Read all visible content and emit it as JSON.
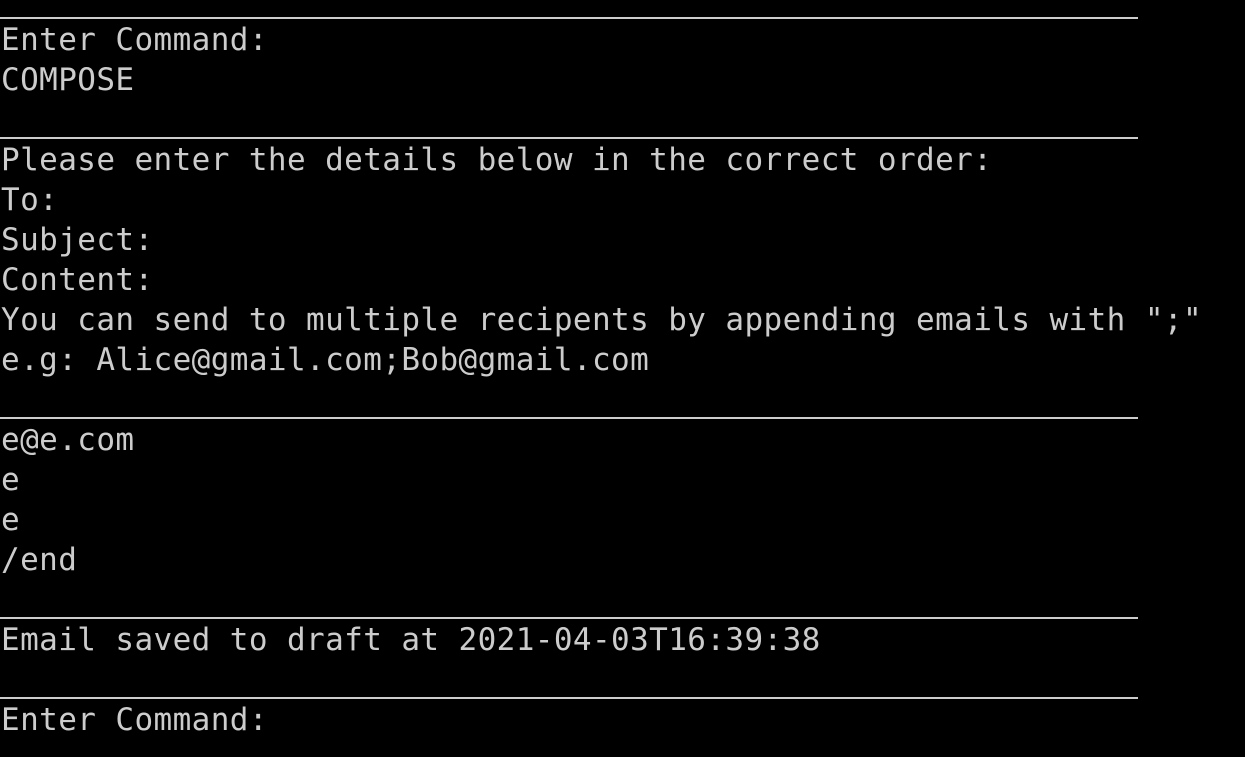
{
  "terminal": {
    "colors": {
      "background": "#000000",
      "foreground": "#cccccc"
    },
    "lines": {
      "prompt1": "Enter Command:",
      "input_command": "COMPOSE",
      "instructions": "Please enter the details below in the correct order:",
      "to_label": "To:",
      "subject_label": "Subject:",
      "content_label": "Content:",
      "hint_multiple": "You can send to multiple recipents by appending emails with \";\"",
      "hint_example": "e.g: Alice@gmail.com;Bob@gmail.com",
      "input_to": "e@e.com",
      "input_subject": "e",
      "input_content": "e",
      "input_end": "/end",
      "status": "Email saved to draft at 2021-04-03T16:39:38",
      "prompt2": "Enter Command:"
    }
  }
}
